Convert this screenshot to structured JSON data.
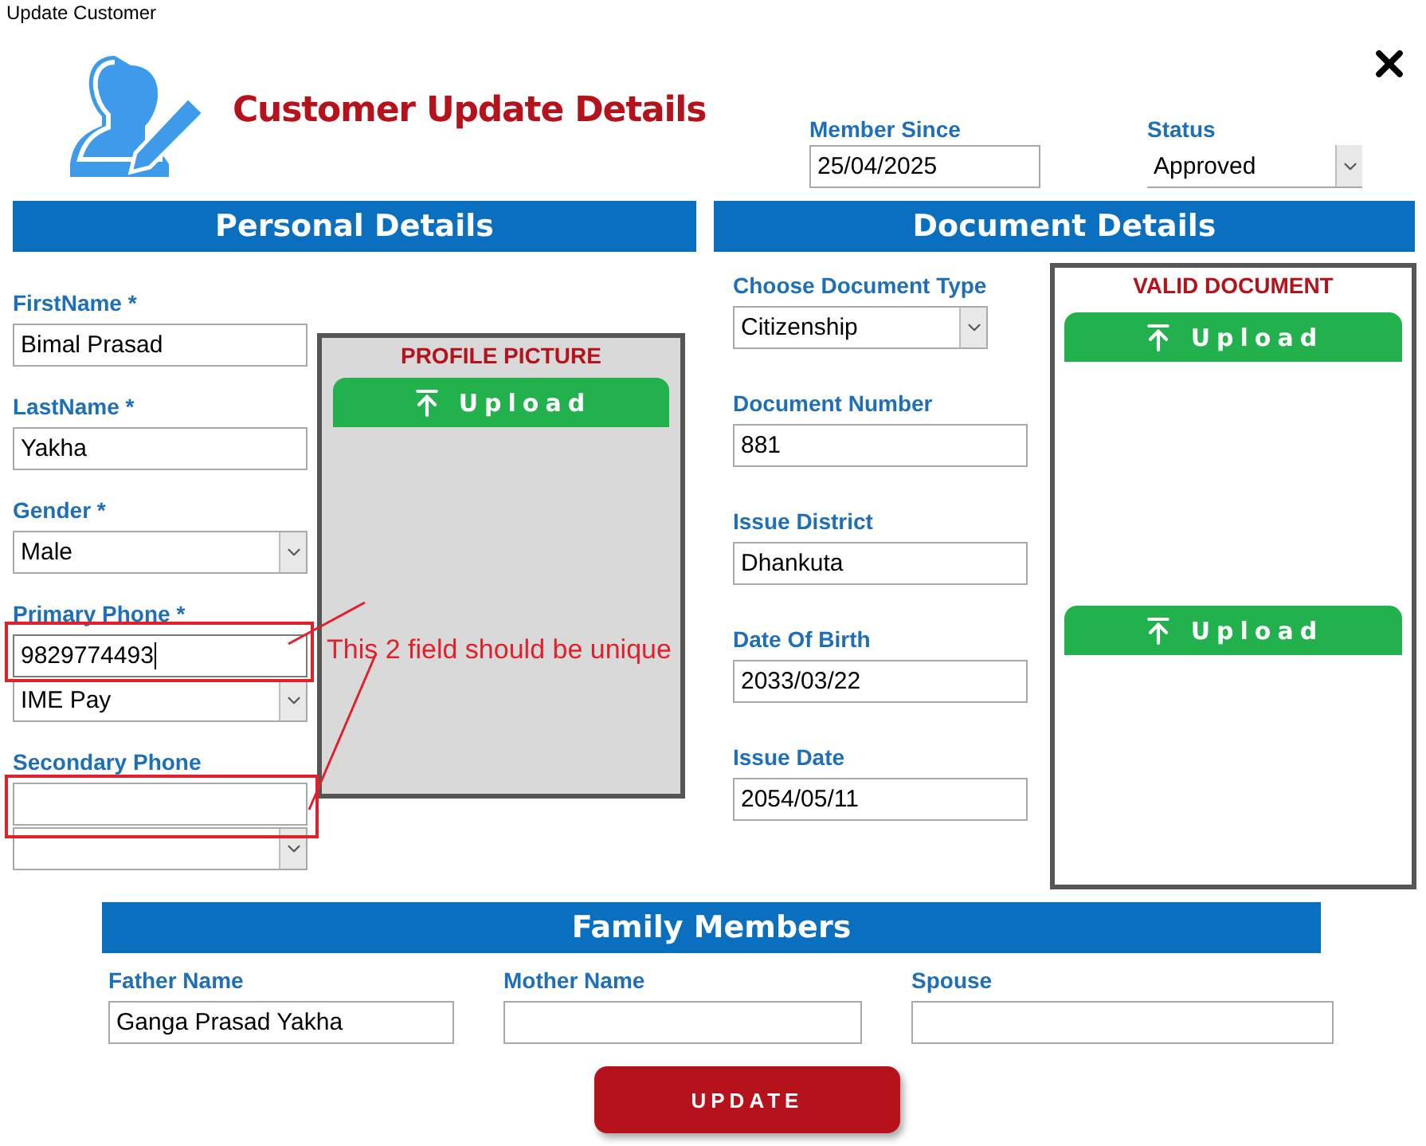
{
  "window": {
    "title": "Update Customer"
  },
  "header": {
    "title": "Customer Update Details"
  },
  "member_since": {
    "label": "Member Since",
    "value": "25/04/2025"
  },
  "status": {
    "label": "Status",
    "value": "Approved"
  },
  "personal": {
    "title": "Personal Details",
    "fields": [
      {
        "kind": "text",
        "label": "FirstName *",
        "value": "Bimal Prasad",
        "focused": false
      },
      {
        "kind": "text",
        "label": "LastName *",
        "value": "Yakha",
        "focused": false
      },
      {
        "kind": "select",
        "label": "Gender *",
        "value": "Male"
      },
      {
        "kind": "text",
        "label": "Primary Phone *",
        "value": "9829774493",
        "focused": true
      },
      {
        "kind": "select",
        "value": "IME Pay"
      },
      {
        "kind": "text",
        "label": "Secondary Phone",
        "focused": false
      },
      {
        "kind": "select"
      }
    ],
    "profile": {
      "title": "PROFILE PICTURE",
      "upload": "Upload"
    }
  },
  "documents": {
    "title": "Document Details",
    "fields": [
      {
        "kind": "select",
        "label": "Choose Document Type",
        "value": "Citizenship"
      },
      {
        "kind": "text",
        "label": "Document Number",
        "value": "881",
        "focused": false
      },
      {
        "kind": "text",
        "label": "Issue District",
        "value": "Dhankuta",
        "focused": false
      },
      {
        "kind": "text",
        "label": "Date Of Birth",
        "value": "2033/03/22",
        "focused": false
      },
      {
        "kind": "text",
        "label": "Issue Date",
        "value": "2054/05/11",
        "focused": false
      }
    ],
    "valid_document": {
      "title": "VALID DOCUMENT",
      "uploads": [
        "Upload",
        "Upload"
      ]
    }
  },
  "family": {
    "title": "Family Members",
    "fields": [
      {
        "label": "Father Name",
        "value": "Ganga Prasad Yakha"
      },
      {
        "label": "Mother Name"
      },
      {
        "label": "Spouse"
      }
    ]
  },
  "update_button": "UPDATE",
  "annotation": {
    "text": "This 2 field should be unique"
  }
}
